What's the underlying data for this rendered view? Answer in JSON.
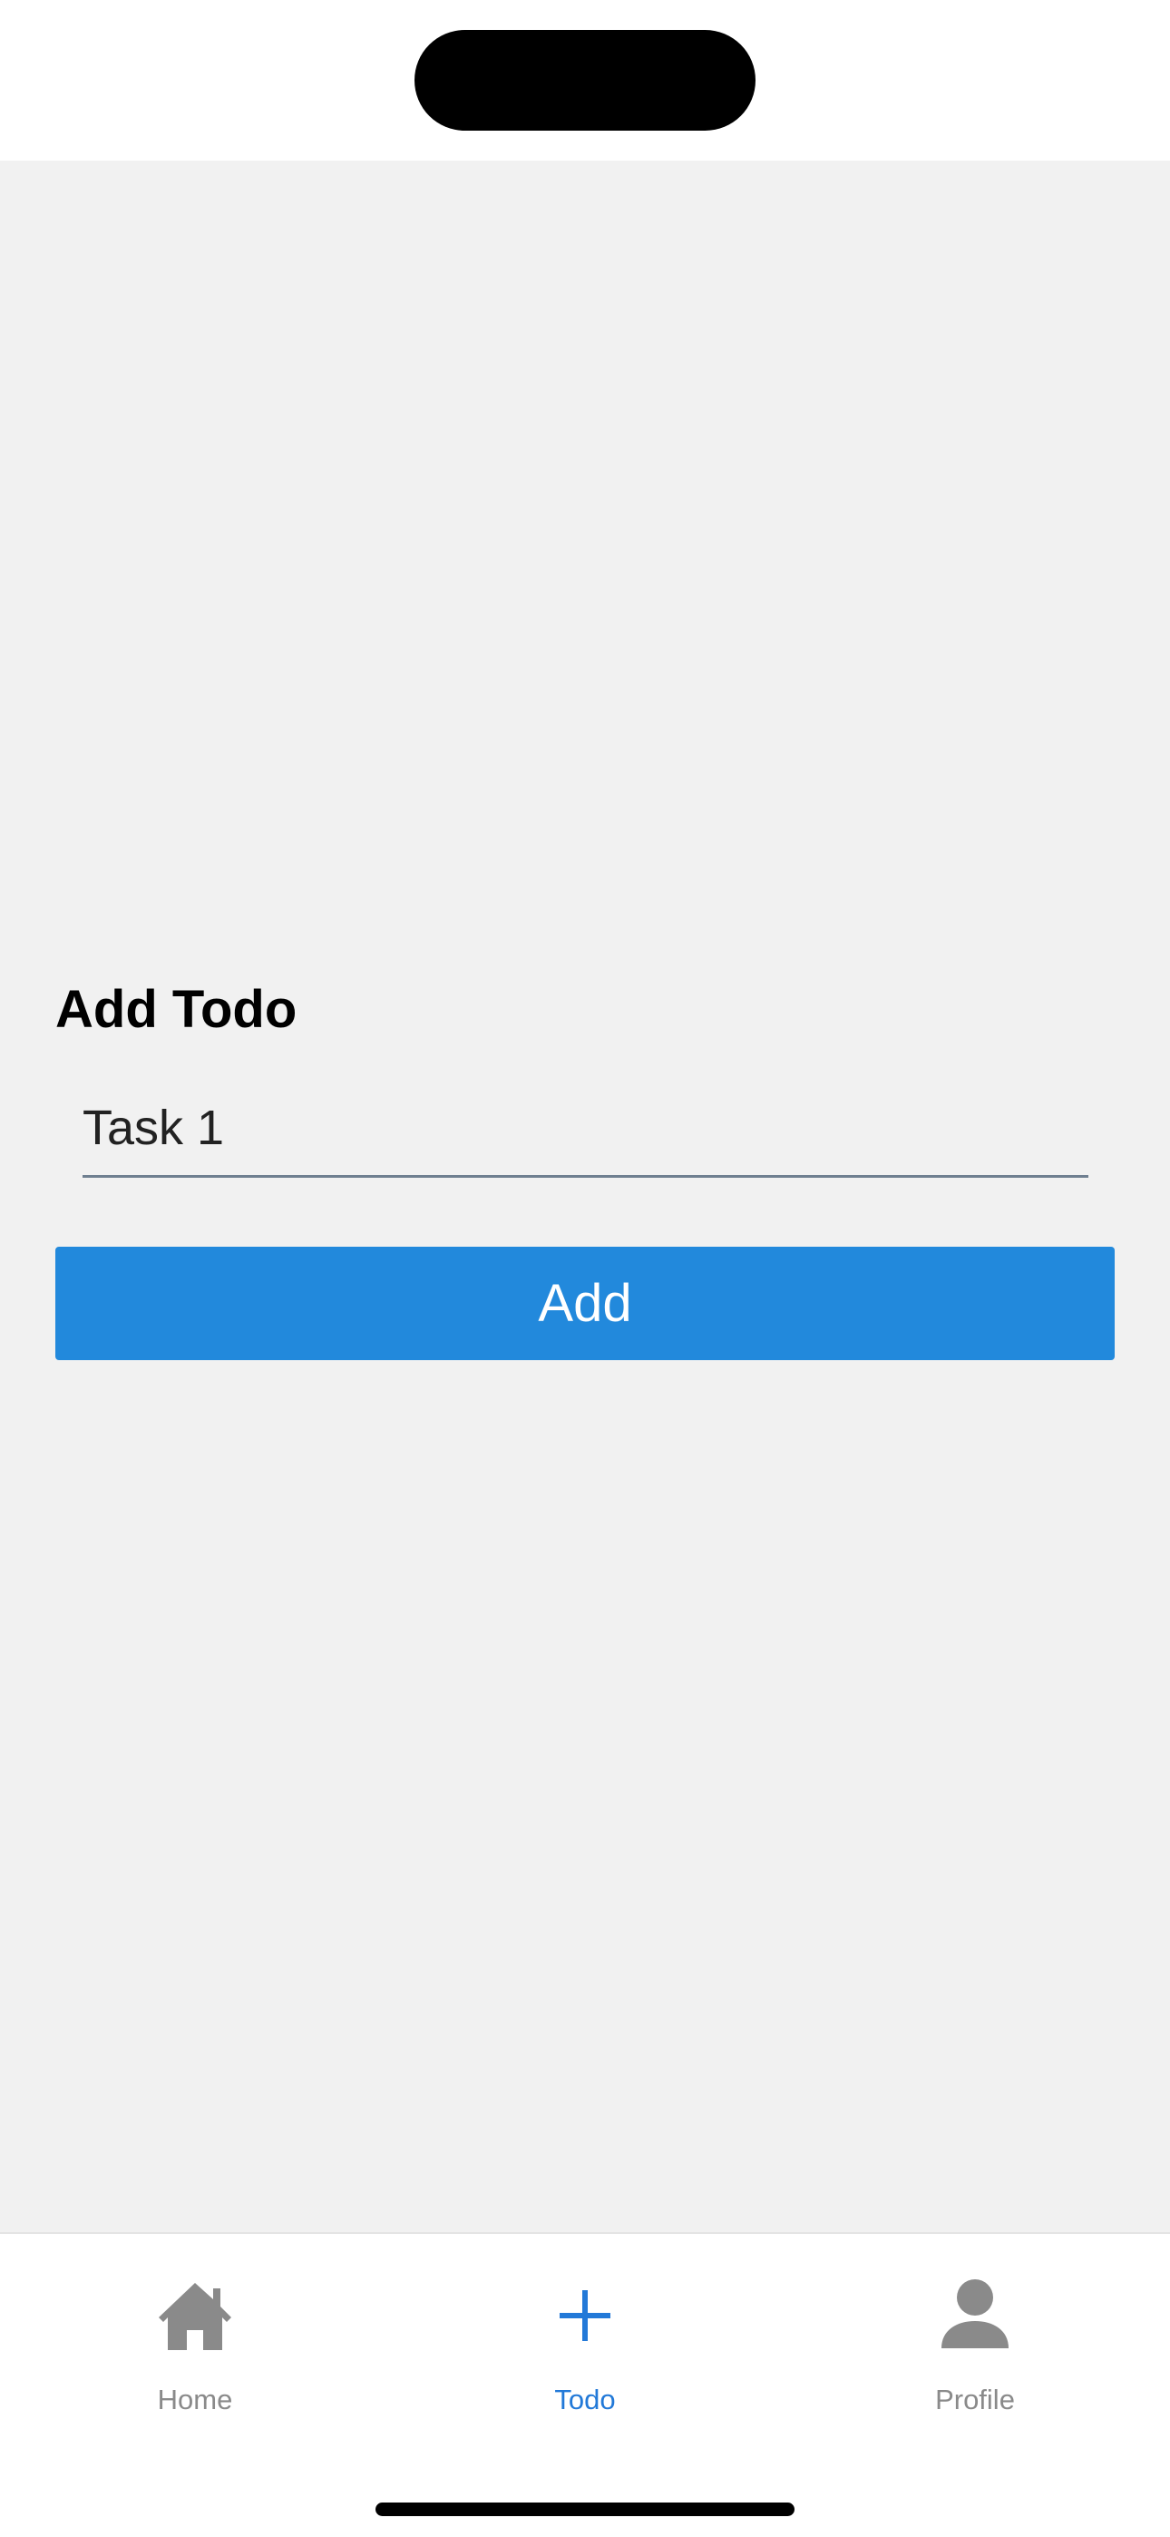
{
  "form": {
    "title": "Add Todo",
    "input_value": "Task 1",
    "add_label": "Add"
  },
  "tabs": [
    {
      "label": "Home",
      "icon": "home-icon",
      "active": false
    },
    {
      "label": "Todo",
      "icon": "plus-icon",
      "active": true
    },
    {
      "label": "Profile",
      "icon": "person-icon",
      "active": false
    }
  ],
  "colors": {
    "accent": "#2289dc",
    "active_tab": "#2279d8",
    "inactive_tab": "#8a8a8a",
    "background": "#f1f1f1"
  }
}
